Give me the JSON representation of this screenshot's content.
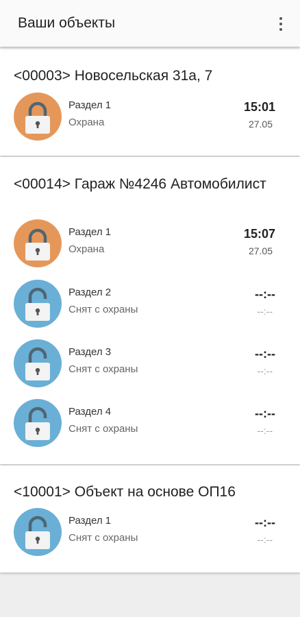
{
  "appbar": {
    "title": "Ваши объекты",
    "menu_icon": "more-vert-icon"
  },
  "colors": {
    "armed": "#e5975a",
    "disarmed": "#6aafd6",
    "lock_body": "#f3f3f3",
    "lock_shackle": "#4f6673"
  },
  "objects": [
    {
      "title": "<00003> Новосельская 31а, 7",
      "parts": [
        {
          "name": "Раздел 1",
          "state": "Охрана",
          "time": "15:01",
          "date": "27.05",
          "armed": true
        }
      ]
    },
    {
      "title": "<00014> Гараж №4246 Автомобилист",
      "parts": [
        {
          "name": "Раздел 1",
          "state": "Охрана",
          "time": "15:07",
          "date": "27.05",
          "armed": true
        },
        {
          "name": "Раздел 2",
          "state": "Снят с охраны",
          "time": "--:--",
          "date": "--:--",
          "armed": false
        },
        {
          "name": "Раздел 3",
          "state": "Снят с охраны",
          "time": "--:--",
          "date": "--:--",
          "armed": false
        },
        {
          "name": "Раздел 4",
          "state": "Снят с охраны",
          "time": "--:--",
          "date": "--:--",
          "armed": false
        }
      ]
    },
    {
      "title": "<10001> Объект на основе ОП16",
      "parts": [
        {
          "name": "Раздел 1",
          "state": "Снят с охраны",
          "time": "--:--",
          "date": "--:--",
          "armed": false
        }
      ]
    }
  ]
}
